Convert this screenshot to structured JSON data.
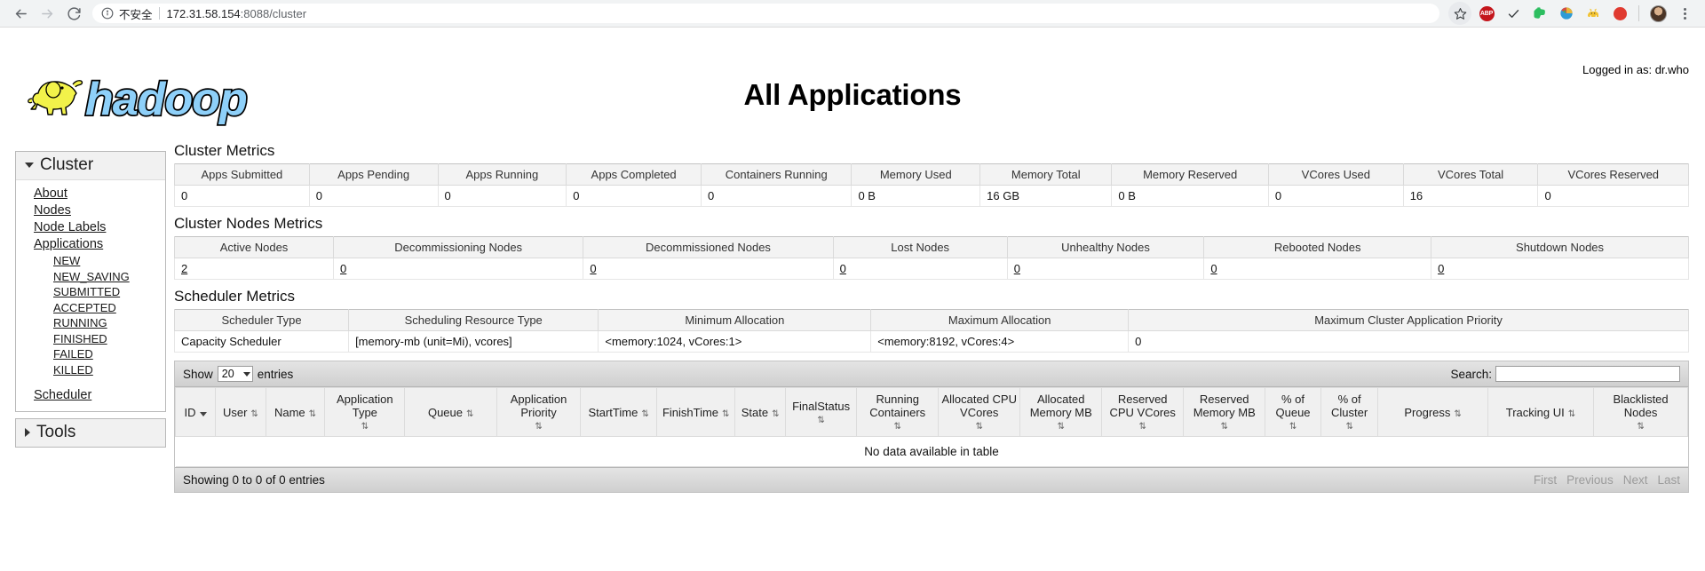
{
  "browser": {
    "back_icon": "back-arrow-icon",
    "forward_icon": "forward-arrow-icon",
    "reload_icon": "reload-icon",
    "info_icon": "info-circle-icon",
    "insecure_label": "不安全",
    "url_host": "172.31.58.154",
    "url_rest": ":8088/cluster",
    "extensions": [
      {
        "name": "bookmark-star-icon",
        "glyph": "☆"
      },
      {
        "name": "adblock-plus-icon",
        "glyph": "ABP"
      },
      {
        "name": "checkmark-icon",
        "glyph": "✓"
      },
      {
        "name": "evernote-icon",
        "glyph": "🐘"
      },
      {
        "name": "palette-extension-icon",
        "glyph": "🎨"
      },
      {
        "name": "cat-extension-icon",
        "glyph": "🐈"
      },
      {
        "name": "red-dot-extension-icon",
        "glyph": ""
      },
      {
        "name": "profile-avatar",
        "glyph": ""
      },
      {
        "name": "chrome-menu-icon",
        "glyph": "⋮"
      }
    ]
  },
  "header": {
    "logged_in": "Logged in as: dr.who",
    "logo_text": "hadoop",
    "page_title": "All Applications"
  },
  "sidebar": {
    "cluster": {
      "label": "Cluster",
      "expanded": true,
      "links": [
        "About",
        "Nodes",
        "Node Labels",
        "Applications"
      ],
      "app_states": [
        "NEW",
        "NEW_SAVING",
        "SUBMITTED",
        "ACCEPTED",
        "RUNNING",
        "FINISHED",
        "FAILED",
        "KILLED"
      ],
      "scheduler": "Scheduler"
    },
    "tools": {
      "label": "Tools",
      "expanded": false
    }
  },
  "cluster_metrics": {
    "title": "Cluster Metrics",
    "headers": [
      "Apps Submitted",
      "Apps Pending",
      "Apps Running",
      "Apps Completed",
      "Containers Running",
      "Memory Used",
      "Memory Total",
      "Memory Reserved",
      "VCores Used",
      "VCores Total",
      "VCores Reserved"
    ],
    "values": [
      "0",
      "0",
      "0",
      "0",
      "0",
      "0 B",
      "16 GB",
      "0 B",
      "0",
      "16",
      "0"
    ]
  },
  "cluster_nodes_metrics": {
    "title": "Cluster Nodes Metrics",
    "headers": [
      "Active Nodes",
      "Decommissioning Nodes",
      "Decommissioned Nodes",
      "Lost Nodes",
      "Unhealthy Nodes",
      "Rebooted Nodes",
      "Shutdown Nodes"
    ],
    "values": [
      "2",
      "0",
      "0",
      "0",
      "0",
      "0",
      "0"
    ]
  },
  "scheduler_metrics": {
    "title": "Scheduler Metrics",
    "headers": [
      "Scheduler Type",
      "Scheduling Resource Type",
      "Minimum Allocation",
      "Maximum Allocation",
      "Maximum Cluster Application Priority"
    ],
    "values": [
      "Capacity Scheduler",
      "[memory-mb (unit=Mi), vcores]",
      "<memory:1024, vCores:1>",
      "<memory:8192, vCores:4>",
      "0"
    ]
  },
  "datatable": {
    "show_label": "Show",
    "page_length": "20",
    "entries_label": "entries",
    "search_label": "Search:",
    "search_value": "",
    "search_placeholder": "",
    "columns": [
      {
        "label": "ID",
        "sort": "desc"
      },
      {
        "label": "User",
        "sort": "both"
      },
      {
        "label": "Name",
        "sort": "both"
      },
      {
        "label": "Application Type",
        "sort": "both"
      },
      {
        "label": "Queue",
        "sort": "both"
      },
      {
        "label": "Application Priority",
        "sort": "both"
      },
      {
        "label": "StartTime",
        "sort": "both"
      },
      {
        "label": "FinishTime",
        "sort": "both"
      },
      {
        "label": "State",
        "sort": "both"
      },
      {
        "label": "FinalStatus",
        "sort": "both"
      },
      {
        "label": "Running Containers",
        "sort": "both"
      },
      {
        "label": "Allocated CPU VCores",
        "sort": "both"
      },
      {
        "label": "Allocated Memory MB",
        "sort": "both"
      },
      {
        "label": "Reserved CPU VCores",
        "sort": "both"
      },
      {
        "label": "Reserved Memory MB",
        "sort": "both"
      },
      {
        "label": "% of Queue",
        "sort": "both"
      },
      {
        "label": "% of Cluster",
        "sort": "both"
      },
      {
        "label": "Progress",
        "sort": "both"
      },
      {
        "label": "Tracking UI",
        "sort": "both"
      },
      {
        "label": "Blacklisted Nodes",
        "sort": "both"
      }
    ],
    "empty_message": "No data available in table",
    "info": "Showing 0 to 0 of 0 entries",
    "pagination": [
      "First",
      "Previous",
      "Next",
      "Last"
    ]
  },
  "colors": {
    "logo_elephant": "#f2f24a",
    "logo_text": "#8ed0f9",
    "toolbar_bg": "#f1f3f4",
    "table_header_bg": "#f1f1f1"
  }
}
